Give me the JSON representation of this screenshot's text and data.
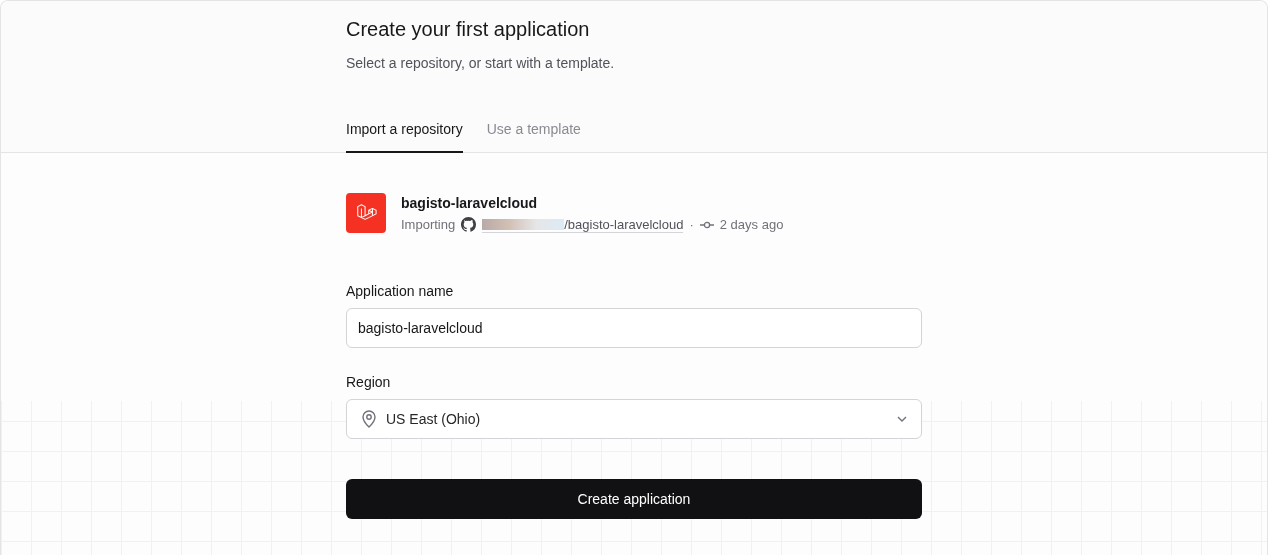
{
  "header": {
    "title": "Create your first application",
    "subtitle": "Select a repository, or start with a template."
  },
  "tabs": [
    {
      "label": "Import a repository",
      "selected": true
    },
    {
      "label": "Use a template",
      "selected": false
    }
  ],
  "repository": {
    "name": "bagisto-laravelcloud",
    "status": "Importing",
    "path": "/bagisto-laravelcloud",
    "separator": "·",
    "commit_time": "2 days ago"
  },
  "form": {
    "name_label": "Application name",
    "name_value": "bagisto-laravelcloud",
    "region_label": "Region",
    "region_value": "US East (Ohio)",
    "submit": "Create application"
  }
}
